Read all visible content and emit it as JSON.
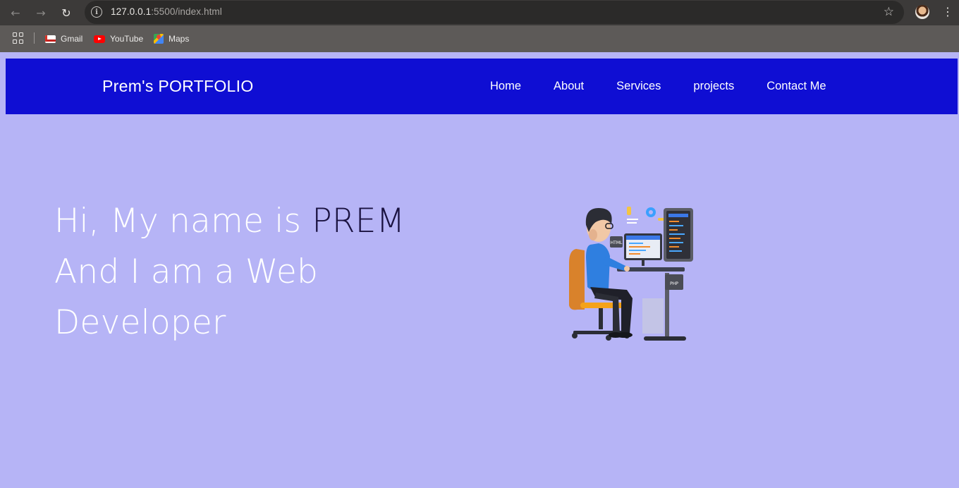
{
  "browser": {
    "url_host": "127.0.0.1",
    "url_rest": ":5500/index.html",
    "bookmarks": [
      {
        "label": "Gmail",
        "icon": "gmail-icon"
      },
      {
        "label": "YouTube",
        "icon": "youtube-icon"
      },
      {
        "label": "Maps",
        "icon": "maps-icon"
      }
    ]
  },
  "navbar": {
    "brand": "Prem's PORTFOLIO",
    "links": [
      "Home",
      "About",
      "Services",
      "projects",
      "Contact Me"
    ]
  },
  "hero": {
    "line1_prefix": "Hi, My name is ",
    "line1_name": "PREM",
    "line2": "And I am a Web",
    "line3": "Developer"
  },
  "illustration": {
    "labels": [
      "HTML",
      "PHP"
    ]
  },
  "colors": {
    "navbar_bg": "#0f0ed3",
    "page_bg": "#b6b4f6",
    "name_accent": "#1a1240"
  }
}
